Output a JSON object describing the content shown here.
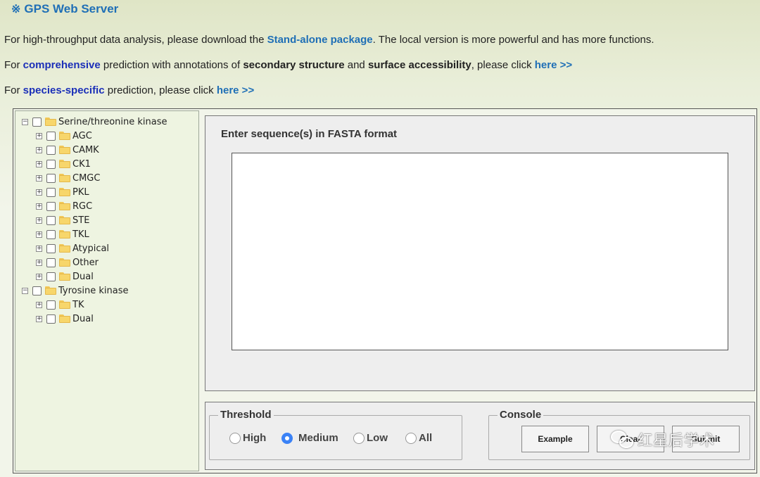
{
  "header": {
    "mark": "※",
    "title": "GPS Web Server"
  },
  "info": {
    "line1": {
      "pre": "For high-throughput data analysis, please download the ",
      "link": "Stand-alone package",
      "post": ". The local version is more powerful and has more functions."
    },
    "line2": {
      "pre": "For ",
      "link1": "comprehensive",
      "mid1": " prediction with annotations of ",
      "bold1": "secondary structure",
      "mid2": " and ",
      "bold2": "surface accessibility",
      "mid3": ", please click ",
      "link2": "here >>"
    },
    "line3": {
      "pre": "For ",
      "link1": "species-specific",
      "mid": " prediction, please click ",
      "link2": "here >>"
    }
  },
  "tree": {
    "groups": [
      {
        "label": "Serine/threonine kinase",
        "children": [
          "AGC",
          "CAMK",
          "CK1",
          "CMGC",
          "PKL",
          "RGC",
          "STE",
          "TKL",
          "Atypical",
          "Other",
          "Dual"
        ]
      },
      {
        "label": "Tyrosine kinase",
        "children": [
          "TK",
          "Dual"
        ]
      }
    ]
  },
  "sequence": {
    "label": "Enter sequence(s) in FASTA format",
    "value": ""
  },
  "threshold": {
    "legend": "Threshold",
    "options": [
      "High",
      "Medium",
      "Low",
      "All"
    ],
    "selected": "Medium"
  },
  "console": {
    "legend": "Console",
    "buttons": [
      "Example",
      "Clear",
      "Submit"
    ]
  },
  "watermark": {
    "text": "红星后学术",
    "icon": "wechat-icon"
  },
  "colors": {
    "link_blue": "#1f6fb6",
    "link_navy": "#1b2fb8",
    "radio_selected": "#3b82f6"
  }
}
